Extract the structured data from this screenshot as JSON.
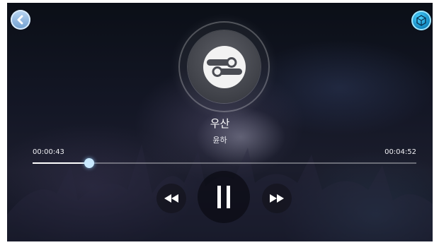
{
  "app": {
    "name": "music-player"
  },
  "toolbar": {
    "back_icon": "chevron-left-icon",
    "cube_icon": "cube-icon"
  },
  "album": {
    "icon": "link-logo-icon"
  },
  "track": {
    "title": "우산",
    "artist": "윤하"
  },
  "progress": {
    "current_time": "00:00:43",
    "total_time": "00:04:52",
    "fraction": 0.147
  },
  "controls": {
    "prev_icon": "rewind-icon",
    "play_icon": "pause-icon",
    "next_icon": "fast-forward-icon"
  },
  "colors": {
    "accent": "#c9e9ff",
    "cube": "#1aa6e0",
    "back": "#8fb8e2"
  }
}
